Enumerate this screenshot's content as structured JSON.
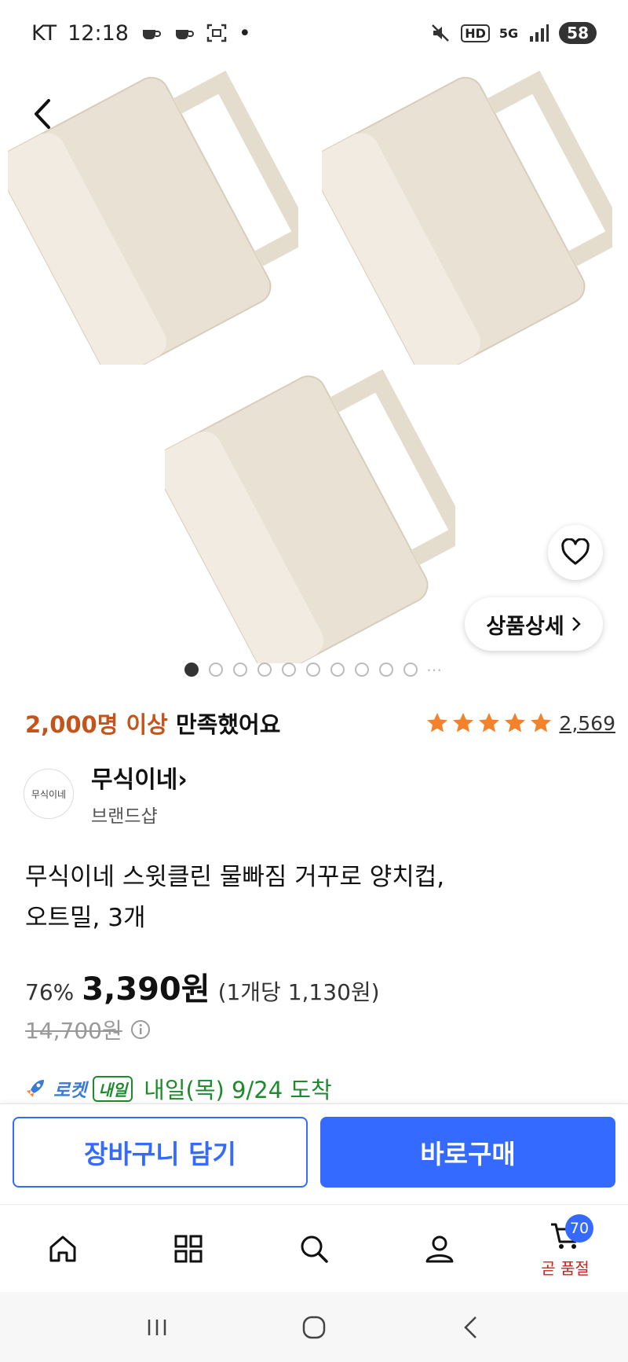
{
  "status_bar": {
    "carrier": "KT",
    "time": "12:18",
    "network": "5G",
    "hd": "HD",
    "battery": "58"
  },
  "gallery": {
    "pages": 10,
    "current_index": 0,
    "more_glyph": "⋯",
    "detail_button": "상품상세"
  },
  "rating": {
    "satisfied_highlight": "2,000명 이상",
    "satisfied_rest": " 만족했어요",
    "stars": 5,
    "review_count": "2,569"
  },
  "brand": {
    "logo_text": "무식이네",
    "name": "무식이네",
    "sub": "브랜드샵"
  },
  "product": {
    "title_line1": "무식이네 스윗클린 물빠짐 거꾸로 양치컵,",
    "title_line2": "오트밀, 3개"
  },
  "price": {
    "discount": "76%",
    "sale": "3,390원",
    "unit": "(1개당 1,130원)",
    "original": "14,700원"
  },
  "delivery": {
    "rocket": "로켓",
    "badge": "내일",
    "arrival": "내일(목) 9/24 도착"
  },
  "actions": {
    "cart": "장바구니 담기",
    "buy": "바로구매"
  },
  "bottom_nav": {
    "cart_count": "70",
    "cart_label": "곧 품절"
  },
  "colors": {
    "primary": "#346aff",
    "accent_orange": "#c4541a",
    "delivery_green": "#1e8a2e",
    "star": "#f5822a",
    "cup": "#e9e1d4"
  }
}
